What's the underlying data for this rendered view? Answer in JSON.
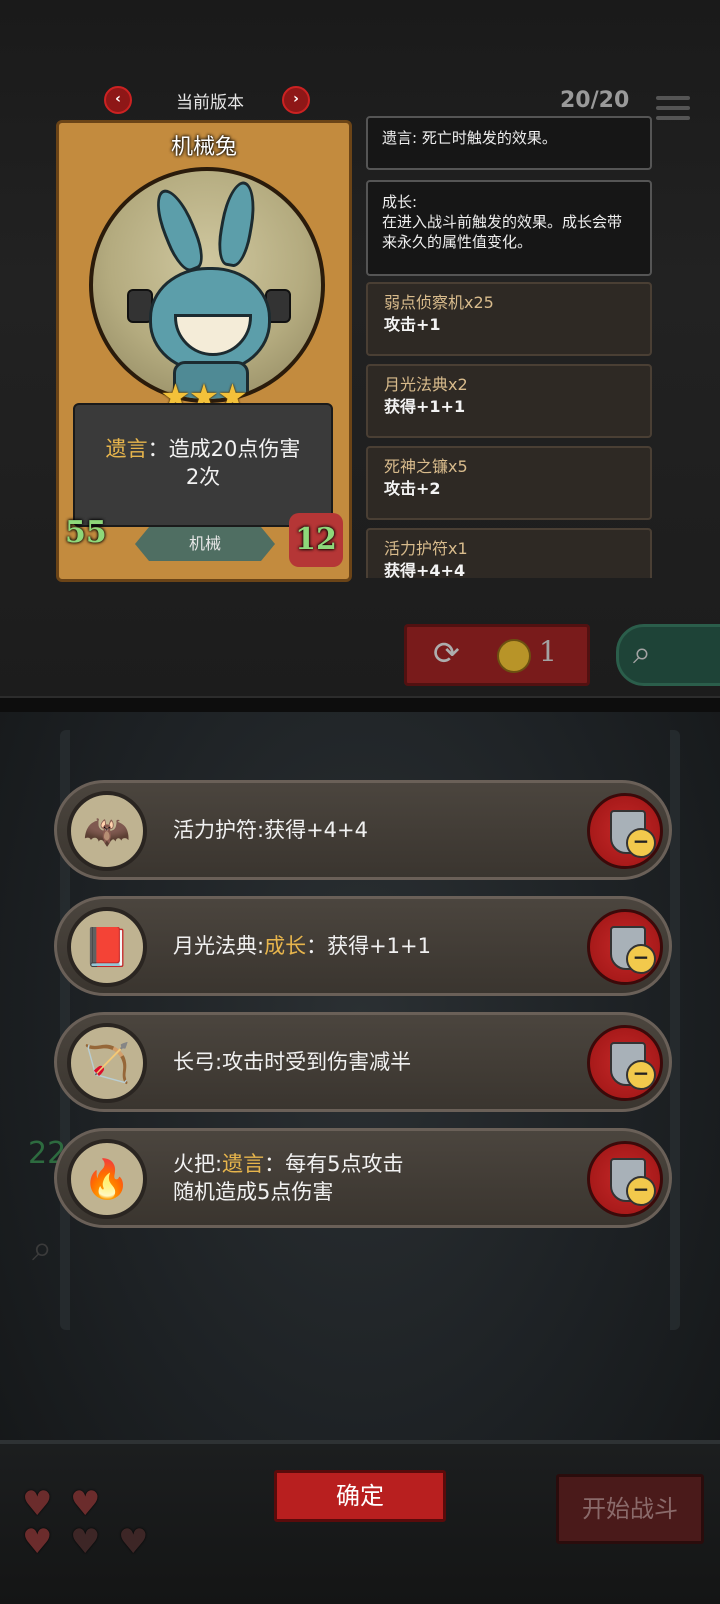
{
  "header": {
    "version_label": "当前版本",
    "counter": "20/20"
  },
  "card": {
    "name": "机械兔",
    "stars": 3,
    "keyword": "遗言",
    "colon": "：",
    "desc_rest": "造成20点伤害",
    "desc_line2": "2次",
    "attack": "55",
    "health": "12",
    "tribe": "机械"
  },
  "info": {
    "deathrattle_text": "遗言: 死亡时触发的效果。",
    "growth_title": "成长:",
    "growth_text": "在进入战斗前触发的效果。成长会带来永久的属性值变化。"
  },
  "items_list": [
    {
      "name": "弱点侦察机x25",
      "effect": "攻击+1"
    },
    {
      "name": "月光法典x2",
      "effect": "获得+1+1"
    },
    {
      "name": "死神之镰x5",
      "effect": "攻击+2"
    },
    {
      "name": "活力护符x1",
      "effect": "获得+4+4"
    }
  ],
  "actions": {
    "refresh_cost": "1"
  },
  "equipment": [
    {
      "icon": "bat-amulet-icon",
      "glyph": "🦇",
      "prefix": "活力护符:获得+4+4",
      "kw": "",
      "rest": "",
      "line2": ""
    },
    {
      "icon": "moon-tome-icon",
      "glyph": "📕",
      "prefix": "月光法典:",
      "kw": "成长",
      "rest": "：获得+1+1",
      "line2": ""
    },
    {
      "icon": "longbow-icon",
      "glyph": "🏹",
      "prefix": "长弓:攻击时受到伤害减半",
      "kw": "",
      "rest": "",
      "line2": ""
    },
    {
      "icon": "torch-icon",
      "glyph": "🔥",
      "prefix": "火把:",
      "kw": "遗言",
      "rest": "：每有5点攻击",
      "line2": "随机造成5点伤害"
    }
  ],
  "bottom": {
    "confirm_label": "确定",
    "start_label": "开始战斗",
    "side_number": "22"
  }
}
